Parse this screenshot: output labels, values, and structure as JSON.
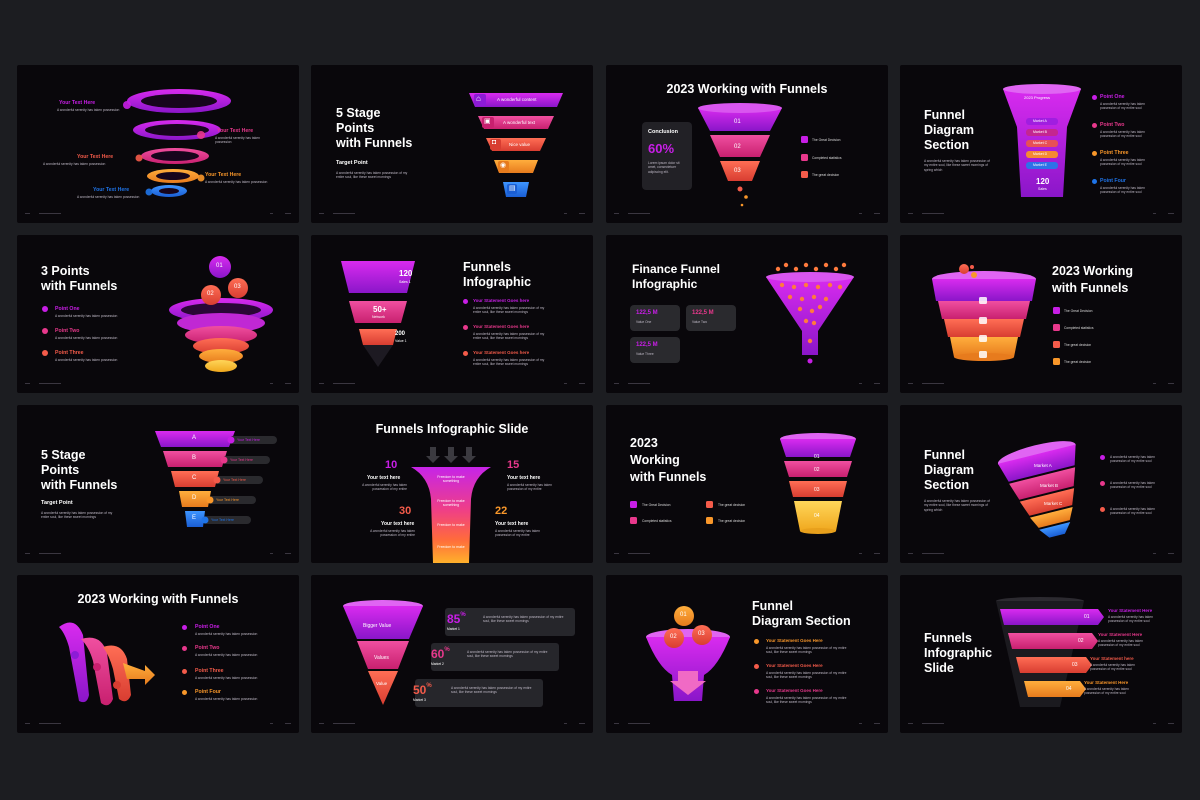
{
  "colors": {
    "page_background": "#1c1d21",
    "slide_background": "#09070b",
    "magenta": "#c81ee6",
    "purple": "#8d1bd6",
    "pink": "#e8388c",
    "coral": "#f45b4a",
    "orange": "#f9972a",
    "yellow": "#f7c431",
    "blue": "#1f74e8",
    "card": "#2a2a2e"
  },
  "s1": {
    "labels": [
      "Your Text Here",
      "Your Text Here",
      "Your Text Here",
      "Your Text Here",
      "Your Text Here"
    ],
    "body": "A wonderful serenity has taken possession"
  },
  "s2": {
    "title1": "5 Stage",
    "title2": "Points",
    "title3": "with Funnels",
    "subtitle": "Target Point",
    "body": "A wonderful serenity has taken possession of my entire soul, like these sweet mornings",
    "steps": [
      "A wonderful content",
      "A wonderful text",
      "Nice value",
      "",
      ""
    ],
    "icons": [
      "home-icon",
      "cart-icon",
      "car-icon",
      "chat-icon",
      "building-icon"
    ]
  },
  "s3": {
    "title": "2023 Working with Funnels",
    "card_title": "Conclusion",
    "card_value": "60%",
    "card_body": "Lorem ipsum dolor sit amet, consectetuer adipiscing elit.",
    "levels": [
      "01",
      "02",
      "03"
    ],
    "items": [
      "The Great Decision",
      "Completed statistics",
      "The great decision"
    ]
  },
  "s4": {
    "title1": "Funnel",
    "title2": "Diagram",
    "title3": "Section",
    "body": "A wonderful serenity has taken possession of my entire soul, like these sweet mornings of spring which",
    "cup_title": "2023 Progress",
    "cup_items": [
      "Market A",
      "Market B",
      "Market C",
      "Market D",
      "Market E"
    ],
    "cup_value": "120",
    "cup_value_label": "Sales",
    "points": [
      "Point One",
      "Point Two",
      "Point Three",
      "Point Four"
    ],
    "point_body": "A wonderful serenity has taken possession of my entire soul"
  },
  "s5": {
    "title1": "3 Points",
    "title2": "with Funnels",
    "points": [
      "Point One",
      "Point Two",
      "Point Three"
    ],
    "point_body": "A wonderful serenity has taken possession",
    "balls": [
      "01",
      "02",
      "03"
    ]
  },
  "s6": {
    "title1": "Funnels",
    "title2": "Infographic",
    "values": [
      "120",
      "50+",
      "200"
    ],
    "value_labels": [
      "Sales 1",
      "Network",
      "Value 1"
    ],
    "items": [
      "Your Statement Goes here",
      "Your Statement Goes here",
      "Your Statement Goes here"
    ],
    "item_body": "A wonderful serenity has taken possession of my entire soul, like these sweet mornings"
  },
  "s7": {
    "title1": "Finance Funnel",
    "title2": "Infographic",
    "cards": [
      {
        "value": "122,5 M",
        "label": "Value One"
      },
      {
        "value": "122,5 M",
        "label": "Value Two"
      },
      {
        "value": "122,5 M",
        "label": "Value Three"
      }
    ]
  },
  "s8": {
    "title1": "2023 Working",
    "title2": "with Funnels",
    "items": [
      "The Great Decision",
      "Completed statistics",
      "The great decision",
      "The great decision"
    ]
  },
  "s9": {
    "title1": "5 Stage",
    "title2": "Points",
    "title3": "with Funnels",
    "subtitle": "Target Point",
    "body": "A wonderful serenity has taken possession of my entire soul, like these sweet mornings",
    "levels": [
      "A",
      "B",
      "C",
      "D",
      "E"
    ],
    "labels": [
      "Your Text Here",
      "Your Text Here",
      "Your Text Here",
      "Your Text Here",
      "Your Text Here"
    ]
  },
  "s10": {
    "title": "Funnels Infographic Slide",
    "n1": "10",
    "n2": "15",
    "n3": "30",
    "n4": "22",
    "heading": "Your text here",
    "heading_body": "A wonderful serenity has taken possession of my entire",
    "stages": [
      "Freedom to make something",
      "Freedom to make something",
      "Freedom to make",
      "Freedom to make"
    ]
  },
  "s11": {
    "title1": "2023",
    "title2": "Working",
    "title3": "with Funnels",
    "items": [
      "The Great Decision",
      "The great decision",
      "Completed statistics",
      "The great decision"
    ],
    "levels": [
      "01",
      "02",
      "03",
      "04"
    ]
  },
  "s12": {
    "title1": "Funnel",
    "title2": "Diagram",
    "title3": "Section",
    "body": "A wonderful serenity has taken possession of my entire soul, like these sweet mornings of spring which",
    "tiers": [
      "Market A",
      "Market B",
      "Market C"
    ],
    "item_body": "A wonderful serenity has taken possession of my entire soul"
  },
  "s13": {
    "title": "2023 Working with Funnels",
    "points": [
      "Point One",
      "Point Two",
      "Point Three",
      "Point Four"
    ],
    "point_body": "A wonderful serenity has taken possession"
  },
  "s14": {
    "funnel_labels": [
      "Bigger Value",
      "Values",
      "Value"
    ],
    "items": [
      {
        "value": "85",
        "label": "Market 1"
      },
      {
        "value": "60",
        "label": "Market 2"
      },
      {
        "value": "50",
        "label": "Market 3"
      }
    ],
    "percent_sign": "%",
    "item_body": "A wonderful serenity has taken possession of my entire soul, like these sweet mornings"
  },
  "s15": {
    "title1": "Funnel",
    "title2": "Diagram Section",
    "balls": [
      "01",
      "02",
      "03"
    ],
    "items": [
      "Your Statement Goes Here",
      "Your Statement Goes Here",
      "Your Statement Goes Here"
    ],
    "item_body": "A wonderful serenity has taken possession of my entire soul, like these sweet mornings"
  },
  "s16": {
    "title1": "Funnels",
    "title2": "Infographic",
    "title3": "Slide",
    "levels": [
      "01",
      "02",
      "03",
      "04"
    ],
    "items": [
      "Your Statement Here",
      "Your Statement Here",
      "Your Statement here",
      "Your Statement Here"
    ],
    "item_body": "A wonderful serenity has taken possession of my entire soul"
  }
}
